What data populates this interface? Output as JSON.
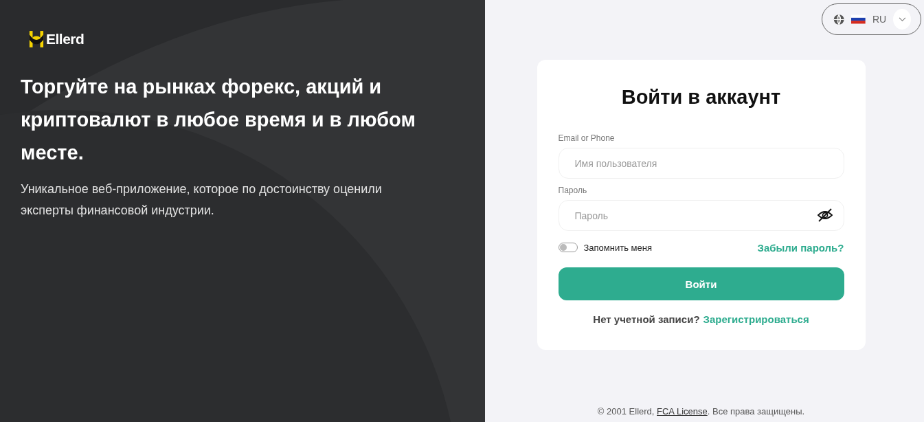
{
  "brand": {
    "name": "Ellerd"
  },
  "promo": {
    "headline": "Торгуйте на рынках форекс, акций и криптовалют в любое время и в любом месте.",
    "text": "Уникальное веб-приложение, которое по достоинству оценили эксперты финансовой индустрии."
  },
  "language": {
    "code": "RU"
  },
  "login": {
    "title": "Войти в аккаунт",
    "fields": [
      {
        "label": "Email or Phone",
        "placeholder": "Имя пользователя",
        "kind": "text"
      },
      {
        "label": "Пароль",
        "placeholder": "Пароль",
        "kind": "password"
      }
    ],
    "remember": {
      "label": "Запомнить меня",
      "on": false
    },
    "forgot": "Забыли пароль?",
    "submit": "Войти",
    "signup_prompt": "Нет учетной записи?",
    "signup_link": "Зарегистрироваться"
  },
  "footer": {
    "text_before": "© 2001 Ellerd, ",
    "link": "FCA License",
    "text_after": ". Все права защищены."
  }
}
